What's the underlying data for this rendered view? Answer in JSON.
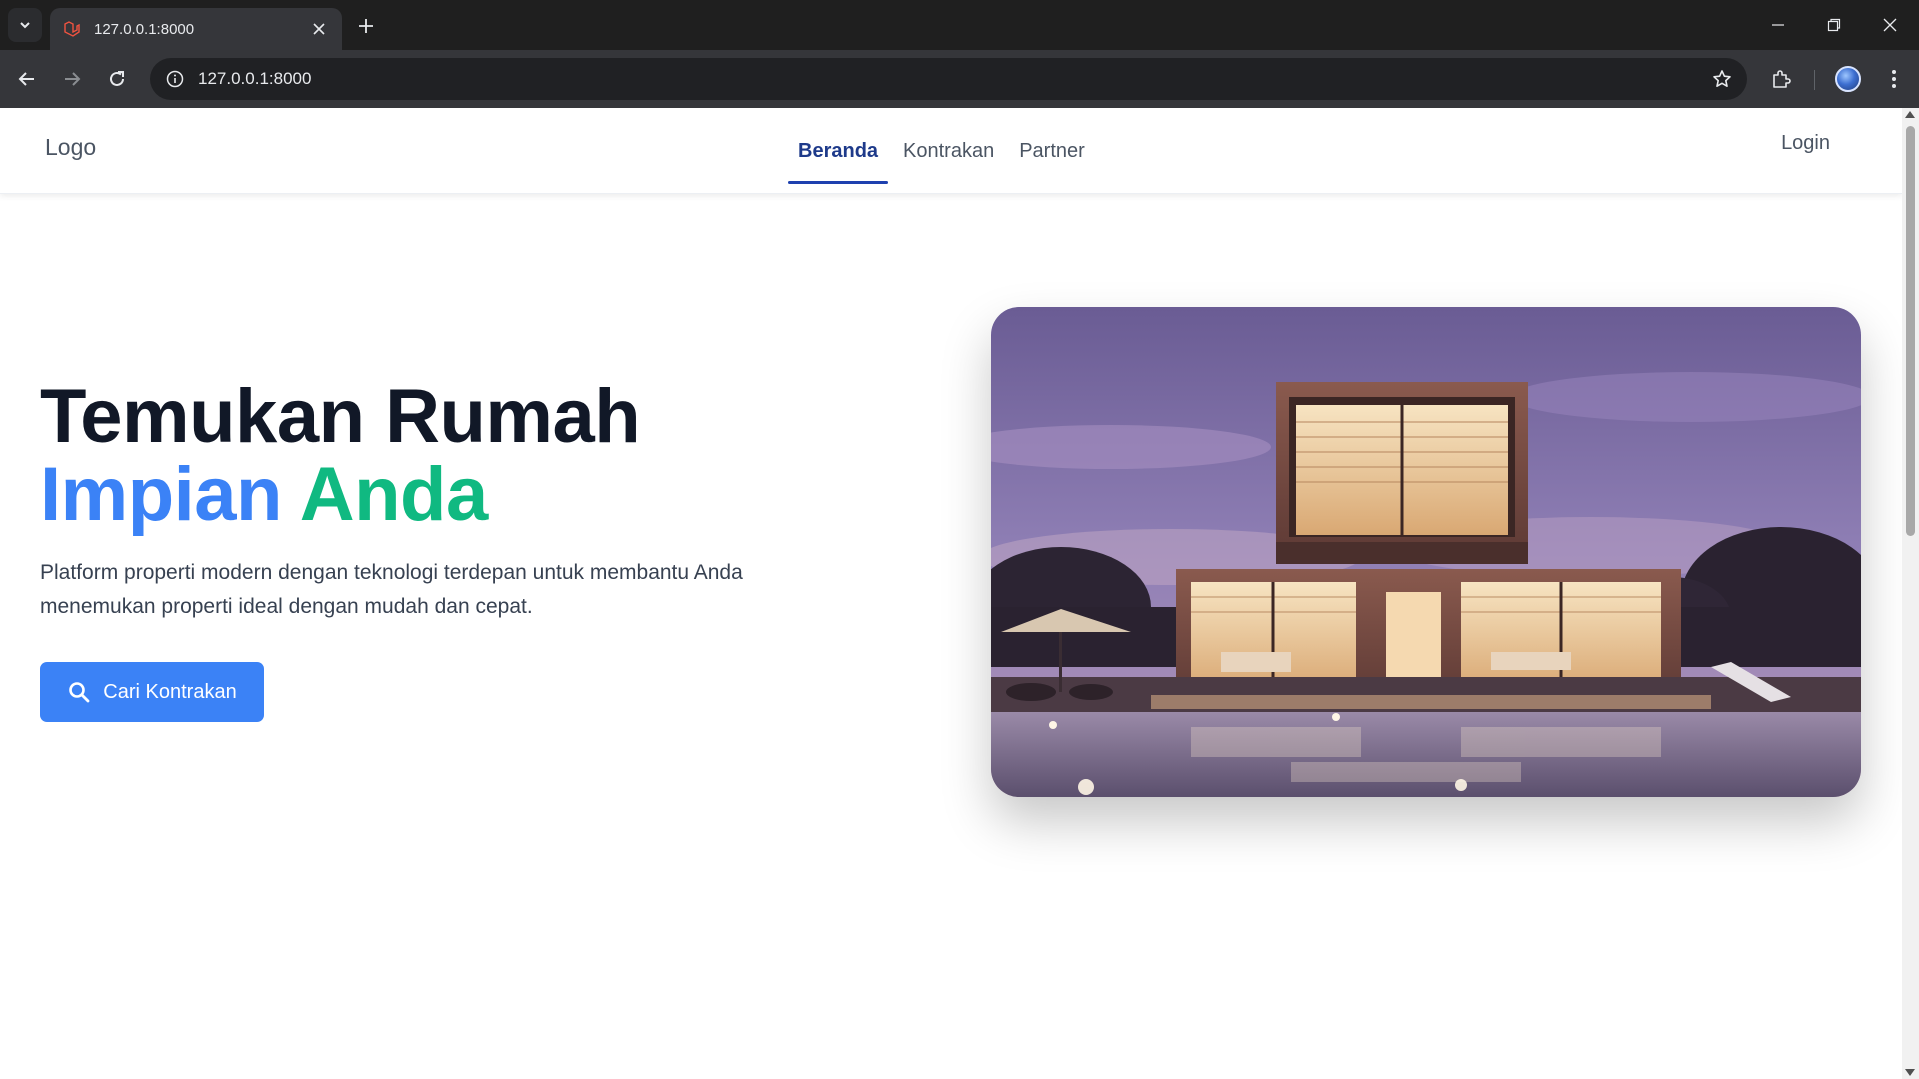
{
  "browser": {
    "tab_title": "127.0.0.1:8000",
    "url": "127.0.0.1:8000",
    "icons": [
      "tab-search-icon",
      "laravel-favicon-icon",
      "close-icon",
      "new-tab-icon",
      "minimize-icon",
      "restore-icon",
      "window-close-icon",
      "back-icon",
      "forward-icon",
      "reload-icon",
      "site-info-icon",
      "bookmark-star-icon",
      "extensions-icon",
      "profile-avatar-icon",
      "menu-dots-icon"
    ]
  },
  "navbar": {
    "logo": "Logo",
    "menu": [
      {
        "label": "Beranda",
        "active": true
      },
      {
        "label": "Kontrakan",
        "active": false
      },
      {
        "label": "Partner",
        "active": false
      }
    ],
    "login": "Login"
  },
  "hero": {
    "title_line1": "Temukan Rumah",
    "title_word_blue": "Impian",
    "title_word_green": "Anda",
    "description": "Platform properti modern dengan teknologi terdepan untuk membantu Anda menemukan properti ideal dengan mudah dan cepat.",
    "cta_label": "Cari Kontrakan",
    "image_subject": "modern-house-with-pool-at-dusk"
  },
  "colors": {
    "accent_blue": "#3b82f6",
    "accent_green": "#10b981",
    "nav_active": "#1e3a8a",
    "heading": "#111827"
  }
}
